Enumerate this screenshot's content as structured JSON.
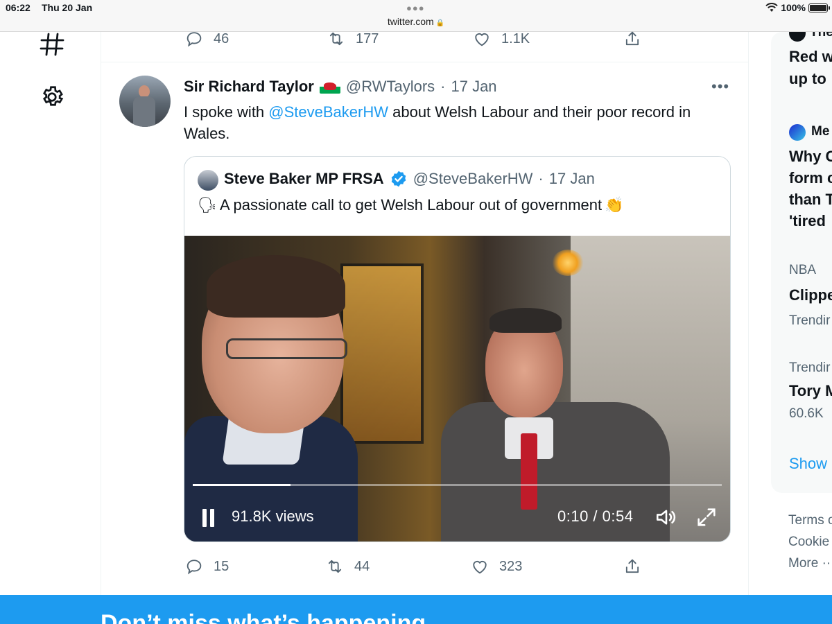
{
  "status_bar": {
    "time": "06:22",
    "date": "Thu 20 Jan",
    "url": "twitter.com",
    "battery": "100%",
    "battery_level": 1.0
  },
  "nav": {
    "icons": [
      "hashtag-icon",
      "gear-icon"
    ]
  },
  "prev_tweet": {
    "replies": "46",
    "retweets": "177",
    "likes": "1.1K"
  },
  "tweet": {
    "author_name": "Sir Richard Taylor",
    "flag": "🏴󠁧󠁢󠁷󠁬󠁳󠁿",
    "handle": "@RWTaylors",
    "separator": "·",
    "date": "17 Jan",
    "more": "•••",
    "text_before": "I spoke with ",
    "mention": "@SteveBakerHW",
    "text_after": " about Welsh Labour and their poor record in Wales.",
    "replies": "15",
    "retweets": "44",
    "likes": "323"
  },
  "quote": {
    "author_name": "Steve Baker MP FRSA",
    "handle": "@SteveBakerHW",
    "separator": "·",
    "date": "17 Jan",
    "emoji_start": "🗣",
    "text": "A passionate call to get Welsh Labour out of government",
    "emoji_end": "👏"
  },
  "video": {
    "views": "91.8K views",
    "time": "0:10 / 0:54",
    "progress": 0.185
  },
  "sidebar": {
    "item1_source": "The",
    "item1_line1": "Red w",
    "item1_line2": "up to",
    "item2_source": "Me",
    "item2_line1": "Why C",
    "item2_line2": "form c",
    "item2_line3": "than T",
    "item2_line4": "'tired",
    "item3_category": "NBA",
    "item3_title": "Clippe",
    "item3_sub": "Trendir",
    "item4_category": "Trendir",
    "item4_title": "Tory M",
    "item4_sub": "60.6K",
    "show_more": "Show",
    "footer_terms": "Terms o",
    "footer_cookie": "Cookie",
    "footer_more": "More ··"
  },
  "banner": {
    "text": "Don’t miss what’s happening"
  },
  "colors": {
    "accent": "#1d9bf0",
    "text": "#0f1419",
    "secondary": "#536471"
  }
}
